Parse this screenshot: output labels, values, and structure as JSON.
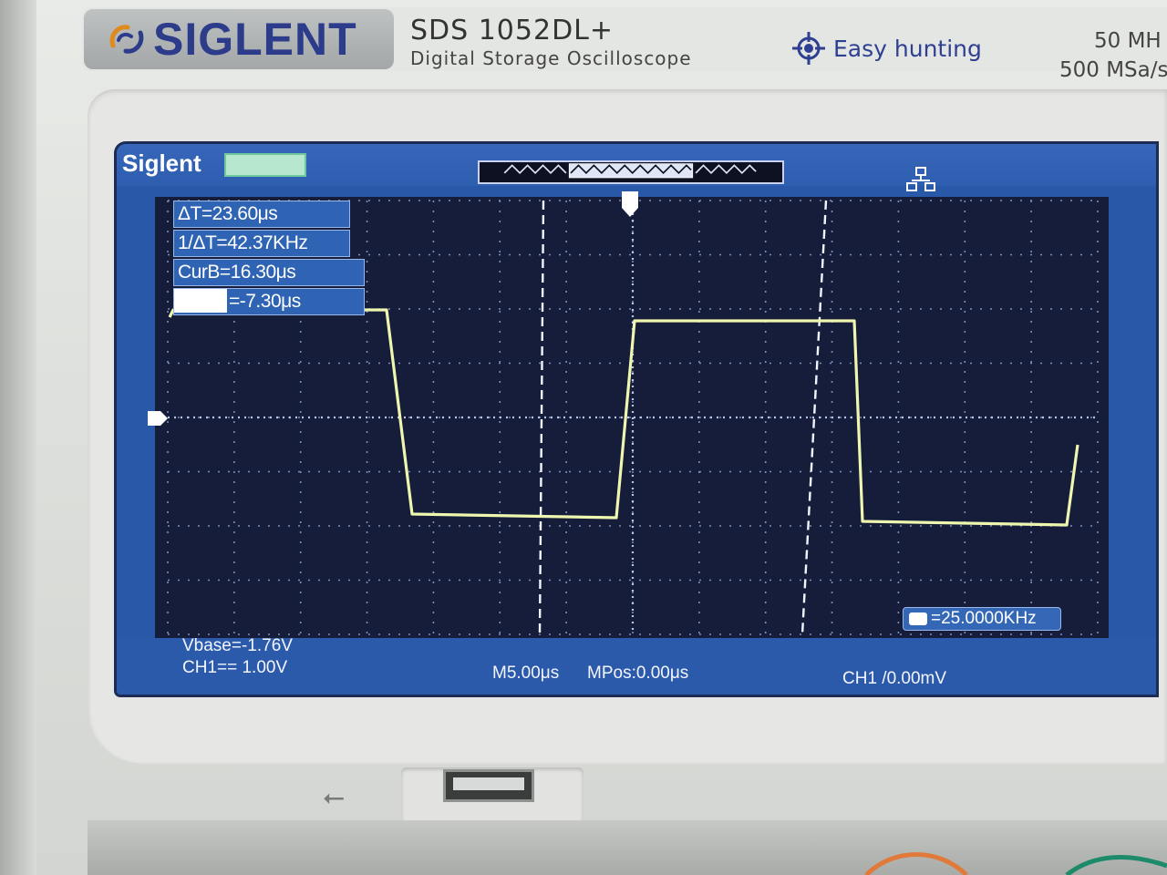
{
  "brand": {
    "logo": "SIGLENT",
    "model": "SDS 1052DL+",
    "subtitle": "Digital Storage Oscilloscope",
    "feature": "Easy hunting",
    "bandwidth": "50 MH",
    "sample_rate": "500 MSa/s"
  },
  "screen": {
    "brand_small": "Siglent",
    "measurements": {
      "delta_t": "ΔT=23.60μs",
      "inv_delta_t": "1/ΔT=42.37KHz",
      "cur_b": "CurB=16.30μs",
      "cur_a_value": "=-7.30μs"
    },
    "frequency": "=25.0000KHz",
    "vbase": "Vbase=-1.76V",
    "ch1_scale": "CH1== 1.00V",
    "timebase": "M5.00μs",
    "mpos": "MPos:0.00μs",
    "trigger": "CH1 /0.00mV"
  },
  "colors": {
    "screen_bg": "#151d3a",
    "screen_frame": "#2a58a8",
    "trace": "#eef6b0",
    "grid_dot": "#7d8fb8"
  },
  "icons": [
    "siglent-swirl-icon",
    "crosshair-icon",
    "network-icon",
    "trigger-marker-icon",
    "channel-marker-icon",
    "usb-icon"
  ]
}
